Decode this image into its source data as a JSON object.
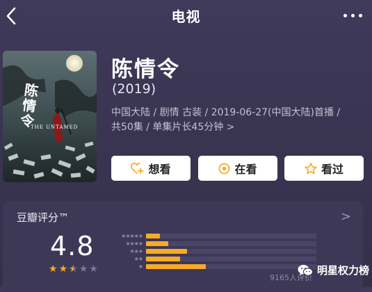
{
  "nav": {
    "title": "电视"
  },
  "poster": {
    "calligraphy": "陈情令",
    "english": "THE UNTAMED"
  },
  "movie": {
    "title": "陈情令",
    "year": "(2019)",
    "meta_line1": "中国大陆 / 剧情 古装 / 2019-06-27(中国大陆)首播 /",
    "meta_line2": "共50集 / 单集片长45分钟",
    "meta_chevron": ">"
  },
  "actions": [
    {
      "label": "想看",
      "icon": "heart-plus-icon"
    },
    {
      "label": "在看",
      "icon": "target-circle-icon"
    },
    {
      "label": "看过",
      "icon": "star-outline-icon"
    }
  ],
  "rating": {
    "title": "豆瓣评分™",
    "chevron": ">",
    "score": "4.8",
    "stars": 2.5,
    "count_text": "9165人评价",
    "distribution": [
      {
        "stars": 5,
        "fraction": 0.08
      },
      {
        "stars": 4,
        "fraction": 0.13
      },
      {
        "stars": 3,
        "fraction": 0.24
      },
      {
        "stars": 2,
        "fraction": 0.2
      },
      {
        "stars": 1,
        "fraction": 0.35
      }
    ],
    "star_color": "#f7ab26"
  },
  "watermark": {
    "text": "明星权力榜",
    "icon": "wechat-icon"
  }
}
